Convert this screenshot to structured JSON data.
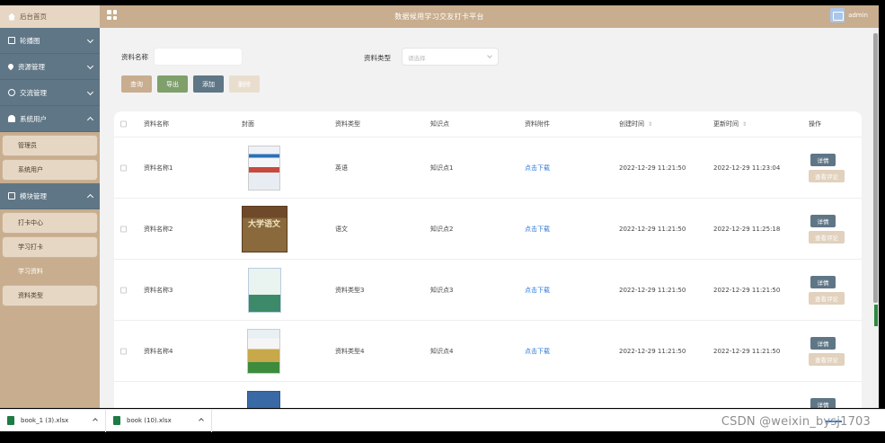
{
  "header": {
    "brand": "后台首页",
    "title": "数据候用学习交友打卡平台",
    "username": "admin"
  },
  "sidebar": {
    "groups": [
      {
        "label": "轮播图",
        "icon": "image-icon",
        "expanded": false,
        "items": []
      },
      {
        "label": "资源管理",
        "icon": "pin-icon",
        "expanded": false,
        "items": []
      },
      {
        "label": "交流管理",
        "icon": "chat-icon",
        "expanded": false,
        "items": []
      },
      {
        "label": "系统用户",
        "icon": "user-icon",
        "expanded": true,
        "items": [
          "管理员",
          "系统用户"
        ]
      },
      {
        "label": "模块管理",
        "icon": "grid-icon",
        "expanded": true,
        "items": [
          "打卡中心",
          "学习打卡",
          "学习资料",
          "资料类型"
        ]
      }
    ],
    "active_item": "学习资料"
  },
  "filters": {
    "name_label": "资料名称",
    "type_label": "资料类型",
    "type_placeholder": "请选择"
  },
  "buttons": {
    "search": "查询",
    "export": "导出",
    "add": "添加",
    "delete": "删除"
  },
  "table": {
    "headers": [
      "资料名称",
      "封面",
      "资料类型",
      "知识点",
      "资料附件",
      "创建时间",
      "更新时间",
      "操作"
    ],
    "rows": [
      {
        "name": "资料名称1",
        "type": "英语",
        "point": "知识点1",
        "attachment": "点击下载",
        "created": "2022-12-29 11:21:50",
        "updated": "2022-12-29 11:23:04"
      },
      {
        "name": "资料名称2",
        "type": "语文",
        "point": "知识点2",
        "attachment": "点击下载",
        "created": "2022-12-29 11:21:50",
        "updated": "2022-12-29 11:25:18"
      },
      {
        "name": "资料名称3",
        "type": "资料类型3",
        "point": "知识点3",
        "attachment": "点击下载",
        "created": "2022-12-29 11:21:50",
        "updated": "2022-12-29 11:21:50"
      },
      {
        "name": "资料名称4",
        "type": "资料类型4",
        "point": "知识点4",
        "attachment": "点击下载",
        "created": "2022-12-29 11:21:50",
        "updated": "2022-12-29 11:21:50"
      }
    ],
    "detail_label": "详情",
    "review_label": "查看评论",
    "cover2_title": "大学语文"
  },
  "downloads": [
    {
      "filename": "book_1 (3).xlsx"
    },
    {
      "filename": "book (10).xlsx"
    }
  ],
  "watermark": "CSDN @weixin_bysj1703"
}
